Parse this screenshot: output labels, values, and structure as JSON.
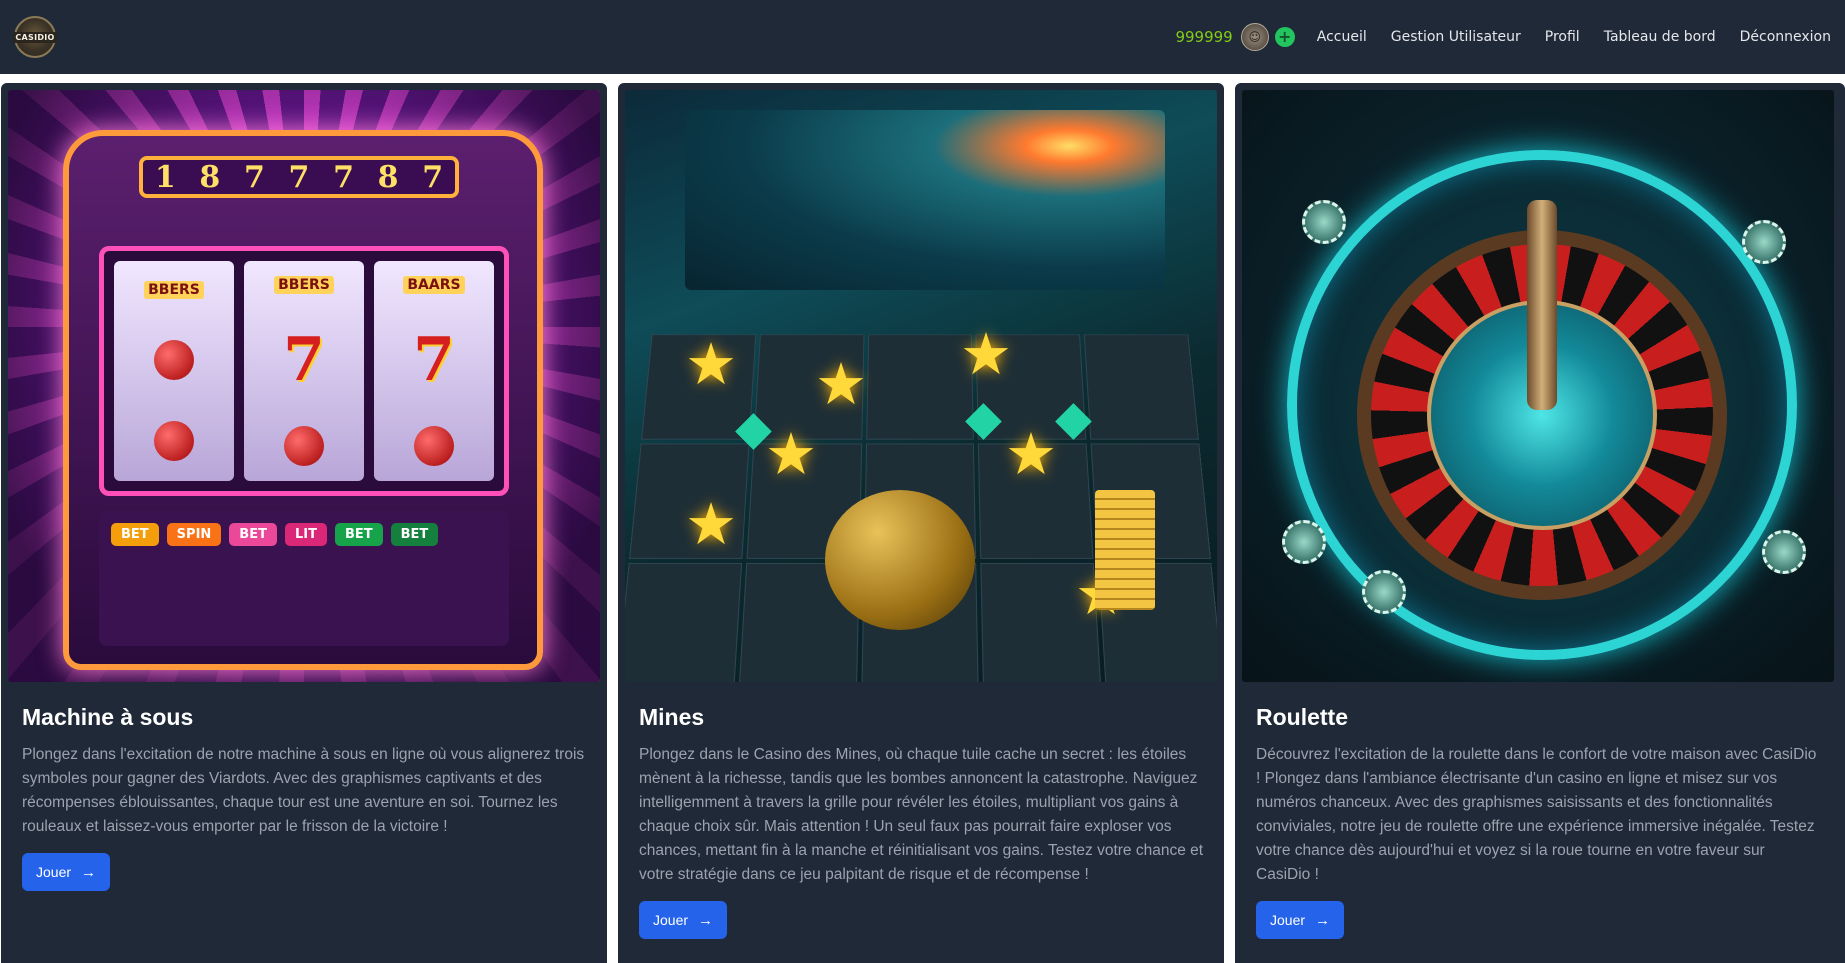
{
  "navbar": {
    "logo_text": "CASIDIO",
    "balance": "999999",
    "links": [
      "Accueil",
      "Gestion Utilisateur",
      "Profil",
      "Tableau de bord",
      "Déconnexion"
    ]
  },
  "games": [
    {
      "title": "Machine à sous",
      "description": "Plongez dans l'excitation de notre machine à sous en ligne où vous alignerez trois symboles pour gagner des Viardots. Avec des graphismes captivants et des récompenses éblouissantes, chaque tour est une aventure en soi. Tournez les rouleaux et laissez-vous emporter par le frisson de la victoire !",
      "button": "Jouer",
      "art": {
        "counter": [
          "1",
          "8",
          "7",
          "7",
          "7",
          "8",
          "7"
        ],
        "reel_labels": [
          "BBERS",
          "BBERS",
          "BAARS"
        ],
        "keys": [
          "BET",
          "SPIN",
          "BET",
          "LIT",
          "BET",
          "BET"
        ]
      }
    },
    {
      "title": "Mines",
      "description": "Plongez dans le Casino des Mines, où chaque tuile cache un secret : les étoiles mènent à la richesse, tandis que les bombes annoncent la catastrophe. Naviguez intelligemment à travers la grille pour révéler les étoiles, multipliant vos gains à chaque choix sûr. Mais attention ! Un seul faux pas pourrait faire exploser vos chances, mettant fin à la manche et réinitialisant vos gains. Testez votre chance et votre stratégie dans ce jeu palpitant de risque et de récompense !",
      "button": "Jouer"
    },
    {
      "title": "Roulette",
      "description": "Découvrez l'excitation de la roulette dans le confort de votre maison avec CasiDio ! Plongez dans l'ambiance électrisante d'un casino en ligne et misez sur vos numéros chanceux. Avec des graphismes saisissants et des fonctionnalités conviviales, notre jeu de roulette offre une expérience immersive inégalée. Testez votre chance dès aujourd'hui et voyez si la roue tourne en votre faveur sur CasiDio !",
      "button": "Jouer"
    }
  ],
  "colors": {
    "navbar_bg": "#1f2937",
    "card_bg": "#1f2937",
    "balance": "#84cc16",
    "button_bg": "#2563eb",
    "plus_bg": "#22c55e"
  },
  "icons": {
    "plus": "plus-circle-icon",
    "arrow": "arrow-right-icon",
    "avatar": "user-avatar-icon"
  }
}
